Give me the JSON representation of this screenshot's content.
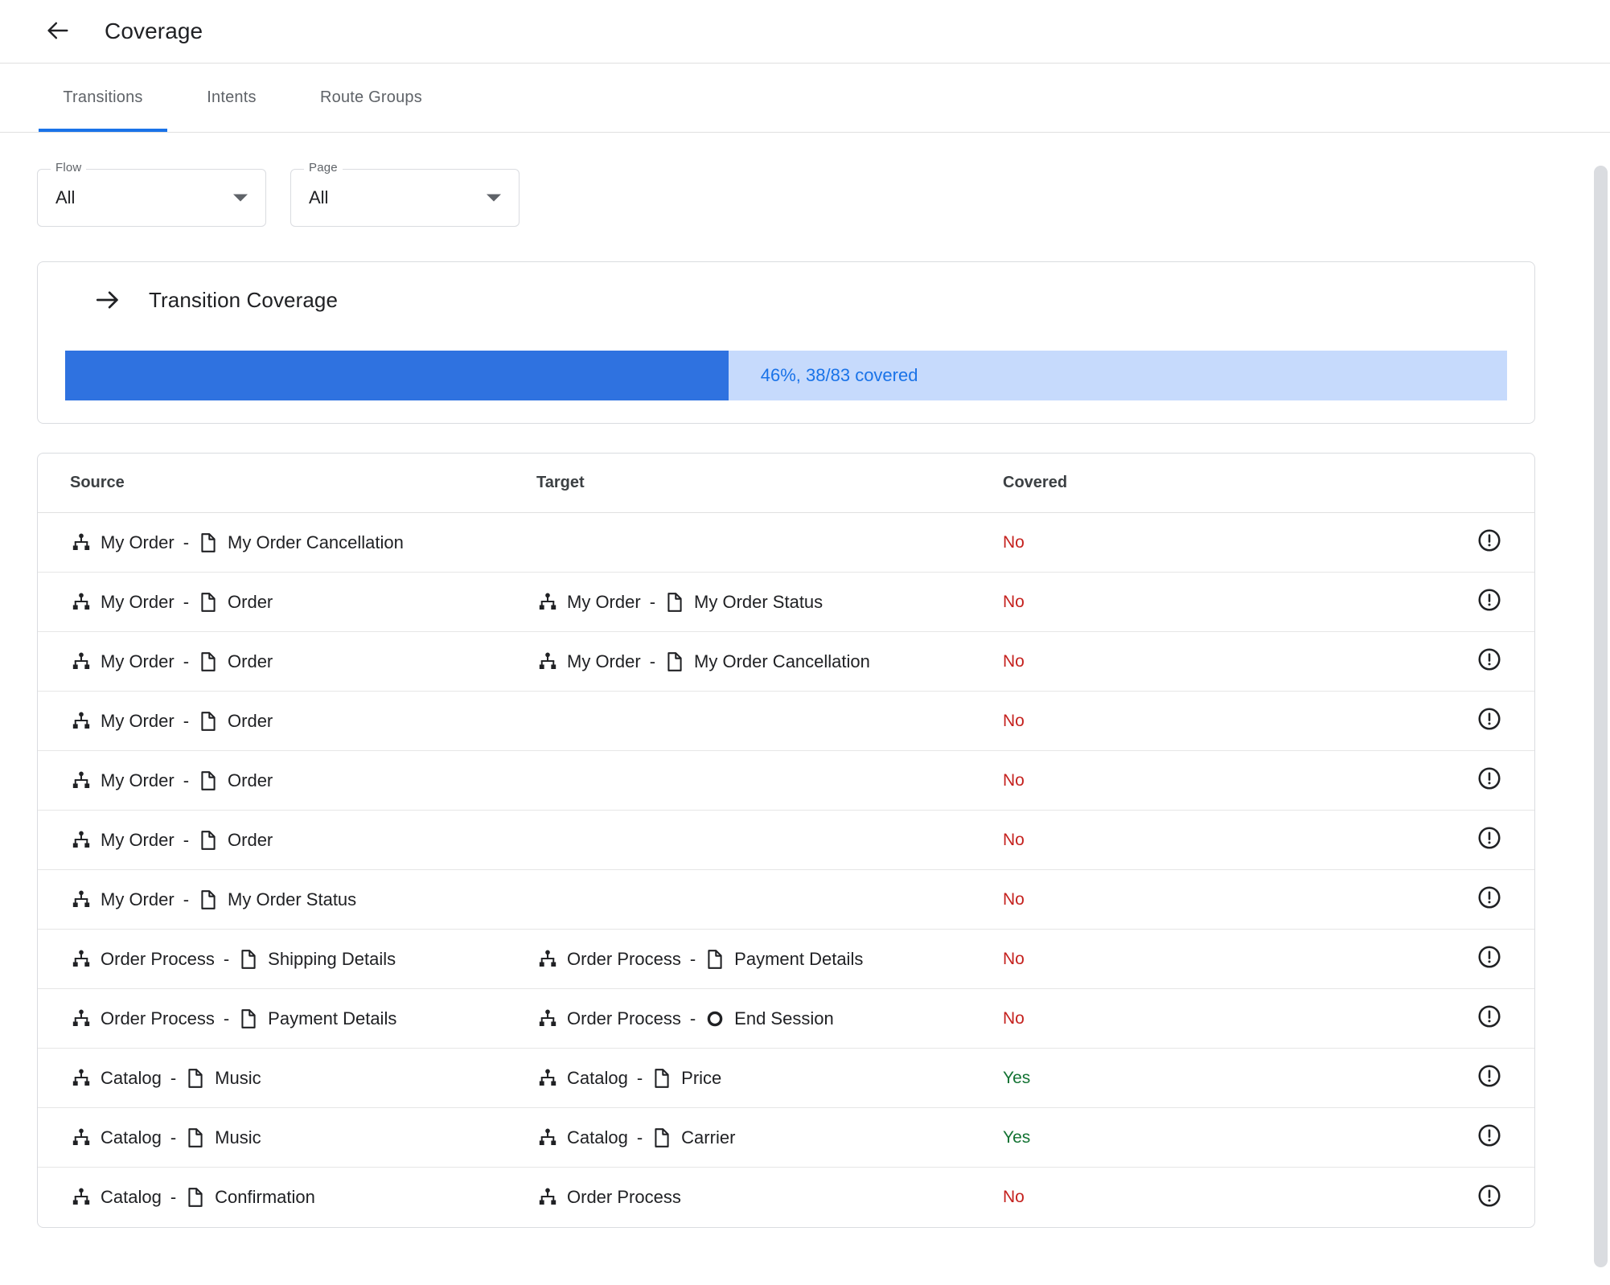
{
  "header": {
    "back_icon": "arrow-left-icon",
    "title": "Coverage"
  },
  "tabs": [
    {
      "label": "Transitions",
      "active": true
    },
    {
      "label": "Intents",
      "active": false
    },
    {
      "label": "Route Groups",
      "active": false
    }
  ],
  "filters": [
    {
      "name": "flow",
      "label": "Flow",
      "value": "All",
      "icon": "chevron-down-icon"
    },
    {
      "name": "page",
      "label": "Page",
      "value": "All",
      "icon": "chevron-down-icon"
    }
  ],
  "coverage_card": {
    "icon": "arrow-right-icon",
    "title": "Transition Coverage",
    "percent": 46,
    "covered": 38,
    "total": 83,
    "progress_text": "46%, 38/83 covered",
    "fill_color": "#2f72e0",
    "track_color": "#c6dafc",
    "text_color": "#1a73e8"
  },
  "table": {
    "columns": [
      "Source",
      "Target",
      "Covered"
    ],
    "status_colors": {
      "yes": "#137333",
      "no": "#c5221f"
    },
    "row_icon": "error-outline-icon",
    "rows": [
      {
        "source": {
          "flow": "My Order",
          "page": "My Order Cancellation",
          "page_icon": "page-icon"
        },
        "target": null,
        "covered": "No"
      },
      {
        "source": {
          "flow": "My Order",
          "page": "Order",
          "page_icon": "page-icon"
        },
        "target": {
          "flow": "My Order",
          "page": "My Order Status",
          "page_icon": "page-icon"
        },
        "covered": "No"
      },
      {
        "source": {
          "flow": "My Order",
          "page": "Order",
          "page_icon": "page-icon"
        },
        "target": {
          "flow": "My Order",
          "page": "My Order Cancellation",
          "page_icon": "page-icon"
        },
        "covered": "No"
      },
      {
        "source": {
          "flow": "My Order",
          "page": "Order",
          "page_icon": "page-icon"
        },
        "target": null,
        "covered": "No"
      },
      {
        "source": {
          "flow": "My Order",
          "page": "Order",
          "page_icon": "page-icon"
        },
        "target": null,
        "covered": "No"
      },
      {
        "source": {
          "flow": "My Order",
          "page": "Order",
          "page_icon": "page-icon"
        },
        "target": null,
        "covered": "No"
      },
      {
        "source": {
          "flow": "My Order",
          "page": "My Order Status",
          "page_icon": "page-icon"
        },
        "target": null,
        "covered": "No"
      },
      {
        "source": {
          "flow": "Order Process",
          "page": "Shipping Details",
          "page_icon": "page-icon"
        },
        "target": {
          "flow": "Order Process",
          "page": "Payment Details",
          "page_icon": "page-icon"
        },
        "covered": "No"
      },
      {
        "source": {
          "flow": "Order Process",
          "page": "Payment Details",
          "page_icon": "page-icon"
        },
        "target": {
          "flow": "Order Process",
          "page": "End Session",
          "page_icon": "end-session-icon"
        },
        "covered": "No"
      },
      {
        "source": {
          "flow": "Catalog",
          "page": "Music",
          "page_icon": "page-icon"
        },
        "target": {
          "flow": "Catalog",
          "page": "Price",
          "page_icon": "page-icon"
        },
        "covered": "Yes"
      },
      {
        "source": {
          "flow": "Catalog",
          "page": "Music",
          "page_icon": "page-icon"
        },
        "target": {
          "flow": "Catalog",
          "page": "Carrier",
          "page_icon": "page-icon"
        },
        "covered": "Yes"
      },
      {
        "source": {
          "flow": "Catalog",
          "page": "Confirmation",
          "page_icon": "page-icon"
        },
        "target": {
          "flow": "Order Process",
          "page": null,
          "page_icon": null
        },
        "covered": "No"
      }
    ]
  },
  "scrollbar": {
    "name": "vertical-scrollbar"
  }
}
